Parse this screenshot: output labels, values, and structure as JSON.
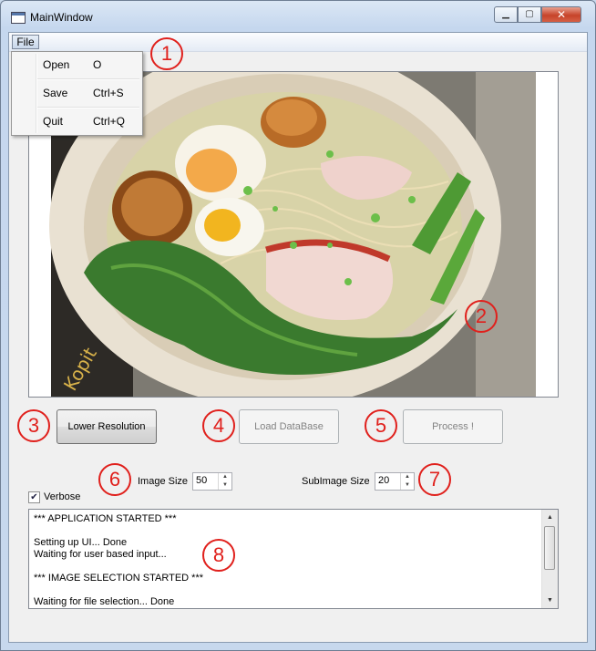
{
  "window": {
    "title": "MainWindow"
  },
  "menubar": {
    "file_label": "File"
  },
  "file_menu": [
    {
      "label": "Open",
      "shortcut": "O"
    },
    {
      "label": "Save",
      "shortcut": "Ctrl+S"
    },
    {
      "label": "Quit",
      "shortcut": "Ctrl+Q"
    }
  ],
  "buttons": {
    "lower_resolution": "Lower Resolution",
    "load_database": "Load DataBase",
    "process": "Process !"
  },
  "image_size": {
    "label": "Image Size",
    "value": "50"
  },
  "subimage_size": {
    "label": "SubImage Size",
    "value": "20"
  },
  "verbose": {
    "label": "Verbose",
    "checked": true
  },
  "log": [
    "*** APPLICATION STARTED ***",
    "",
    "Setting up UI... Done",
    "Waiting for user based input...",
    "",
    "*** IMAGE SELECTION STARTED ***",
    "",
    "Waiting for file selection... Done"
  ],
  "callouts": [
    "1",
    "2",
    "3",
    "4",
    "5",
    "6",
    "7",
    "8"
  ],
  "colors": {
    "callout": "#e0201c",
    "titlebar": "#c5d7ee"
  }
}
